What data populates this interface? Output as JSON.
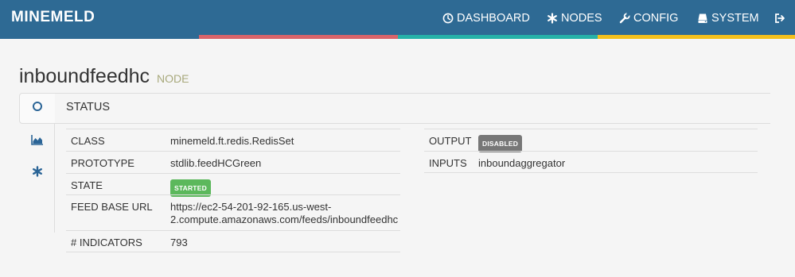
{
  "navbar": {
    "brand": "MINEMELD",
    "items": [
      {
        "label": "DASHBOARD",
        "icon": "dashboard-icon"
      },
      {
        "label": "NODES",
        "icon": "asterisk-icon"
      },
      {
        "label": "CONFIG",
        "icon": "wrench-icon"
      },
      {
        "label": "SYSTEM",
        "icon": "server-icon"
      }
    ],
    "logout_icon": "logout-icon"
  },
  "colors": {
    "navbar": "#2e6a94",
    "stripe_red": "#d9646a",
    "stripe_teal": "#26b2a8",
    "stripe_yellow": "#f3c01c",
    "badge_started": "#5cb85c",
    "badge_disabled": "#777777",
    "link": "#2a6496"
  },
  "page": {
    "title": "inboundfeedhc",
    "subtitle": "NODE"
  },
  "tabs": [
    {
      "icon": "circle-icon",
      "active": true
    },
    {
      "icon": "area-chart-icon",
      "active": false
    },
    {
      "icon": "asterisk-icon",
      "active": false
    }
  ],
  "status": {
    "title": "STATUS",
    "left_rows": {
      "class": {
        "key": "CLASS",
        "value": "minemeld.ft.redis.RedisSet"
      },
      "prototype": {
        "key": "PROTOTYPE",
        "value": "stdlib.feedHCGreen"
      },
      "state": {
        "key": "STATE",
        "value": "STARTED"
      },
      "feed_base_url": {
        "key": "FEED BASE URL",
        "value_line1": "https://ec2-54-201-92-165.us-west-",
        "value_line2": "2.compute.amazonaws.com/feeds/inboundfeedhc"
      },
      "indicators": {
        "key": "# INDICATORS",
        "value": "793"
      }
    },
    "right_rows": {
      "output": {
        "key": "OUTPUT",
        "value": "DISABLED"
      },
      "inputs": {
        "key": "INPUTS",
        "value": "inboundaggregator"
      }
    }
  }
}
